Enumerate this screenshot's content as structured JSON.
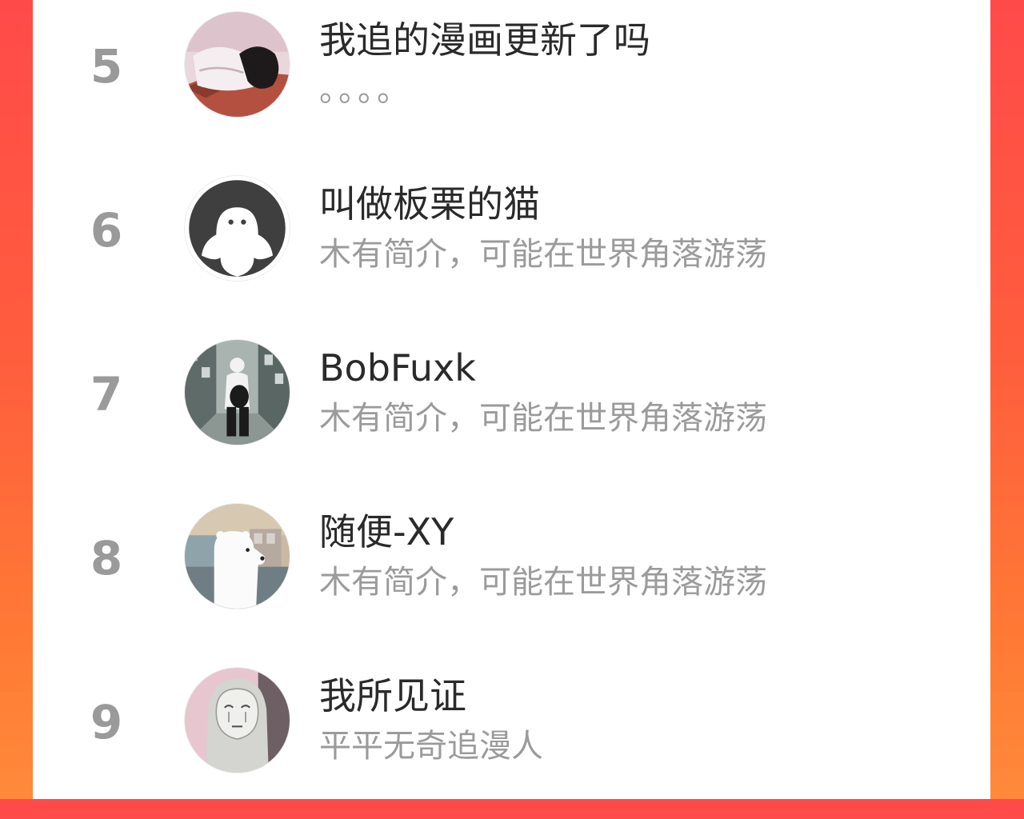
{
  "colors": {
    "background_gradient_start": "#ff4a4a",
    "background_gradient_end": "#ff8a3a",
    "panel": "#ffffff",
    "rank_text": "#9a9a9a",
    "name_text": "#2a2a2a",
    "bio_text": "#9b9b9b"
  },
  "list": {
    "items": [
      {
        "rank": "5",
        "name": "我追的漫画更新了吗",
        "bio": "。。。。",
        "avatar_icon": "sleeping-anime-avatar-icon"
      },
      {
        "rank": "6",
        "name": "叫做板栗的猫",
        "bio": "木有简介，可能在世界角落游荡",
        "avatar_icon": "default-ghost-avatar-icon"
      },
      {
        "rank": "7",
        "name": "BobFuxk",
        "bio": "木有简介，可能在世界角落游荡",
        "avatar_icon": "street-walker-avatar-icon"
      },
      {
        "rank": "8",
        "name": "随便-XY",
        "bio": "木有简介，可能在世界角落游荡",
        "avatar_icon": "polar-bear-avatar-icon"
      },
      {
        "rank": "9",
        "name": "我所见证",
        "bio": "平平无奇追漫人",
        "avatar_icon": "no-face-avatar-icon"
      }
    ]
  }
}
